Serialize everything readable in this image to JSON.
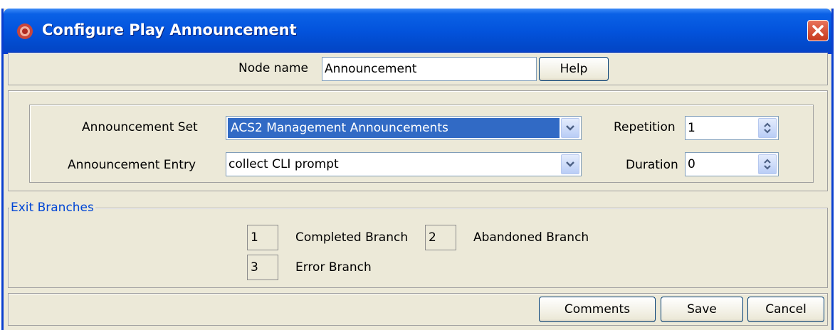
{
  "window": {
    "title": "Configure Play Announcement"
  },
  "node": {
    "label": "Node name",
    "value": "Announcement",
    "help_label": "Help"
  },
  "announcement": {
    "set_label": "Announcement Set",
    "set_value": "ACS2 Management Announcements",
    "entry_label": "Announcement Entry",
    "entry_value": "collect CLI prompt",
    "repetition_label": "Repetition",
    "repetition_value": "1",
    "duration_label": "Duration",
    "duration_value": "0"
  },
  "exit_branches": {
    "title": "Exit Branches",
    "completed_num": "1",
    "completed_label": "Completed Branch",
    "abandoned_num": "2",
    "abandoned_label": "Abandoned Branch",
    "error_num": "3",
    "error_label": "Error Branch"
  },
  "footer": {
    "comments_label": "Comments",
    "save_label": "Save",
    "cancel_label": "Cancel"
  },
  "colors": {
    "titlebar": "#0353dc",
    "selection": "#316ac5",
    "group_title": "#0046d5"
  }
}
